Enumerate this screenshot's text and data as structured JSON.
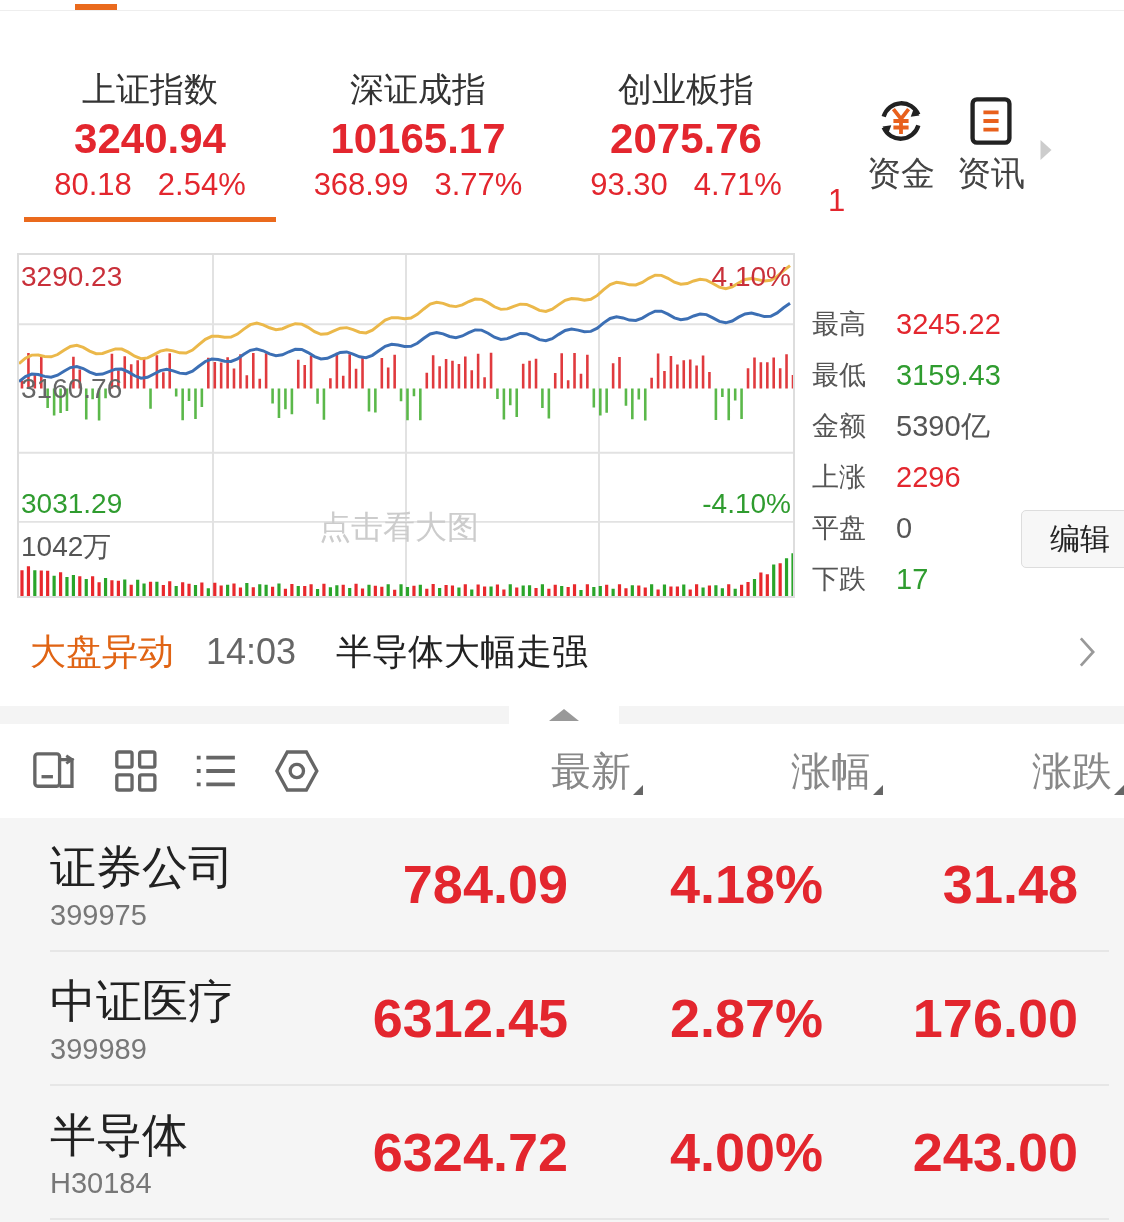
{
  "indices": [
    {
      "name": "上证指数",
      "value": "3240.94",
      "change": "80.18",
      "percent": "2.54%",
      "selected": true
    },
    {
      "name": "深证成指",
      "value": "10165.17",
      "change": "368.99",
      "percent": "3.77%",
      "selected": false
    },
    {
      "name": "创业板指",
      "value": "2075.76",
      "change": "93.30",
      "percent": "4.71%",
      "selected": false
    }
  ],
  "partial_index": "1",
  "shortcuts": [
    {
      "label": "资金",
      "kind": "funds"
    },
    {
      "label": "资讯",
      "kind": "news"
    }
  ],
  "chart": {
    "high_label": "3290.23",
    "high_pct": "4.10%",
    "mid_label": "3160.76",
    "low_label": "3031.29",
    "low_pct": "-4.10%",
    "volume_label": "1042万",
    "hint": "点击看大图"
  },
  "stats": [
    {
      "label": "最高",
      "value": "3245.22",
      "color": "#e3262e"
    },
    {
      "label": "最低",
      "value": "3159.43",
      "color": "#2f9c2f"
    },
    {
      "label": "金额",
      "value": "5390亿",
      "color": "#555555"
    },
    {
      "label": "上涨",
      "value": "2296",
      "color": "#e3262e"
    },
    {
      "label": "平盘",
      "value": "0",
      "color": "#555555"
    },
    {
      "label": "下跌",
      "value": "17",
      "color": "#2f9c2f"
    }
  ],
  "edit_button": "编辑",
  "alert": {
    "tag": "大盘异动",
    "time": "14:03",
    "text": "半导体大幅走强"
  },
  "columns": [
    "最新",
    "涨幅",
    "涨跌"
  ],
  "rows": [
    {
      "name": "证券公司",
      "code": "399975",
      "price": "784.09",
      "percent": "4.18%",
      "change": "31.48"
    },
    {
      "name": "中证医疗",
      "code": "399989",
      "price": "6312.45",
      "percent": "2.87%",
      "change": "176.00"
    },
    {
      "name": "半导体",
      "code": "H30184",
      "price": "6324.72",
      "percent": "4.00%",
      "change": "243.00"
    }
  ]
}
